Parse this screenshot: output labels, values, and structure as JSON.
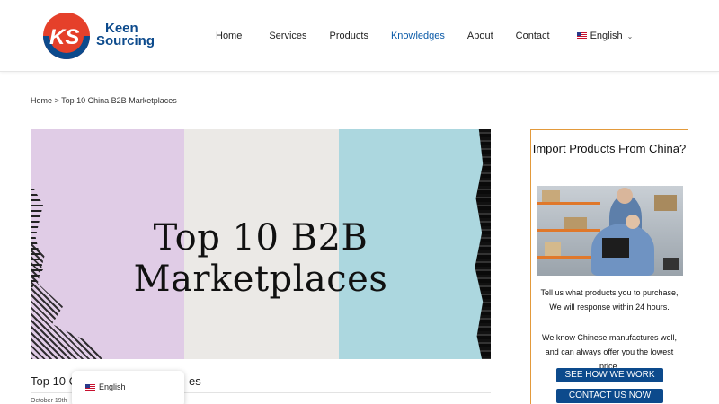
{
  "logo": {
    "line1": "Keen",
    "line2": "Sourcing",
    "colors": {
      "red": "#e5402a",
      "blue": "#0c4a8c"
    }
  },
  "nav": {
    "items": [
      {
        "label": "Home"
      },
      {
        "label": "Services"
      },
      {
        "label": "Products"
      },
      {
        "label": "Knowledges",
        "active": true
      },
      {
        "label": "About"
      },
      {
        "label": "Contact"
      }
    ],
    "language": "English",
    "language_icon": "us-flag-icon"
  },
  "breadcrumb": {
    "home": "Home",
    "separator": ">",
    "current": "Top 10 China B2B Marketplaces"
  },
  "hero": {
    "title": "Top 10 B2B Marketplaces",
    "colors": [
      "#e0cce6",
      "#ebe9e6",
      "#acd7df"
    ]
  },
  "post": {
    "title_start": "Top 10 C",
    "title_end": "es",
    "date": "October 19th"
  },
  "lang_popup": {
    "label": "English"
  },
  "sidebar": {
    "title": "Import Products From China?",
    "text1": "Tell us what products you to purchase, We will response within 24 hours.",
    "text2": "We know Chinese manufactures well, and can always offer you the lowest price.",
    "btn1": "SEE HOW WE WORK",
    "btn2": "CONTACT US NOW",
    "border_color": "#e39a3b",
    "button_color": "#0c4a8c"
  }
}
